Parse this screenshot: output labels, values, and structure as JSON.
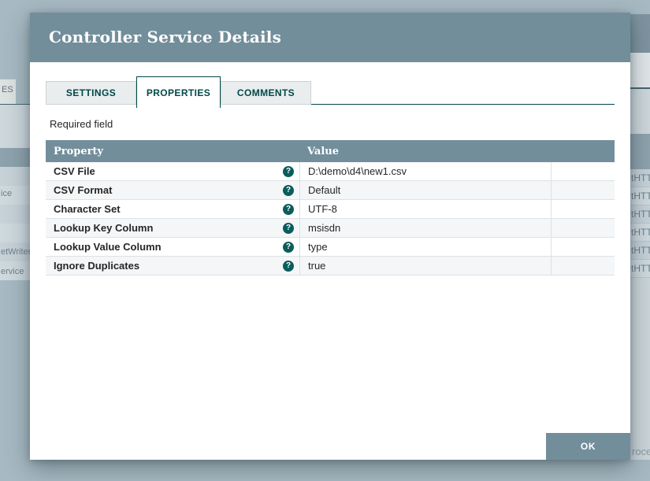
{
  "dialog": {
    "title": "Controller Service Details",
    "tabs": [
      {
        "label": "SETTINGS",
        "active": false
      },
      {
        "label": "PROPERTIES",
        "active": true
      },
      {
        "label": "COMMENTS",
        "active": false
      }
    ],
    "required_field_label": "Required field",
    "table": {
      "property_header": "Property",
      "value_header": "Value",
      "help_glyph": "?",
      "rows": [
        {
          "property": "CSV File",
          "value": "D:\\demo\\d4\\new1.csv"
        },
        {
          "property": "CSV Format",
          "value": "Default"
        },
        {
          "property": "Character Set",
          "value": "UTF-8"
        },
        {
          "property": "Lookup Key Column",
          "value": "msisdn"
        },
        {
          "property": "Lookup Value Column",
          "value": "type"
        },
        {
          "property": "Ignore Duplicates",
          "value": "true"
        }
      ]
    },
    "ok_button_label": "OK"
  },
  "background": {
    "left_fragments": {
      "tab": "ES",
      "row1": "ice",
      "row2": "etWriter",
      "row3": "ervice"
    },
    "right_fragments": {
      "rows": [
        "tHTT",
        "tHTT",
        "tHTT",
        "tHTT",
        "tHTT",
        "tHTT"
      ],
      "bottom": "roce"
    }
  },
  "colors": {
    "header_bar": "#728E9B",
    "accent_teal": "#004849",
    "help_icon_bg": "#0B5C5C",
    "overlay": "#A7B9C2",
    "row_alt": "#F4F6F8",
    "row_border": "#DCE2E5"
  }
}
